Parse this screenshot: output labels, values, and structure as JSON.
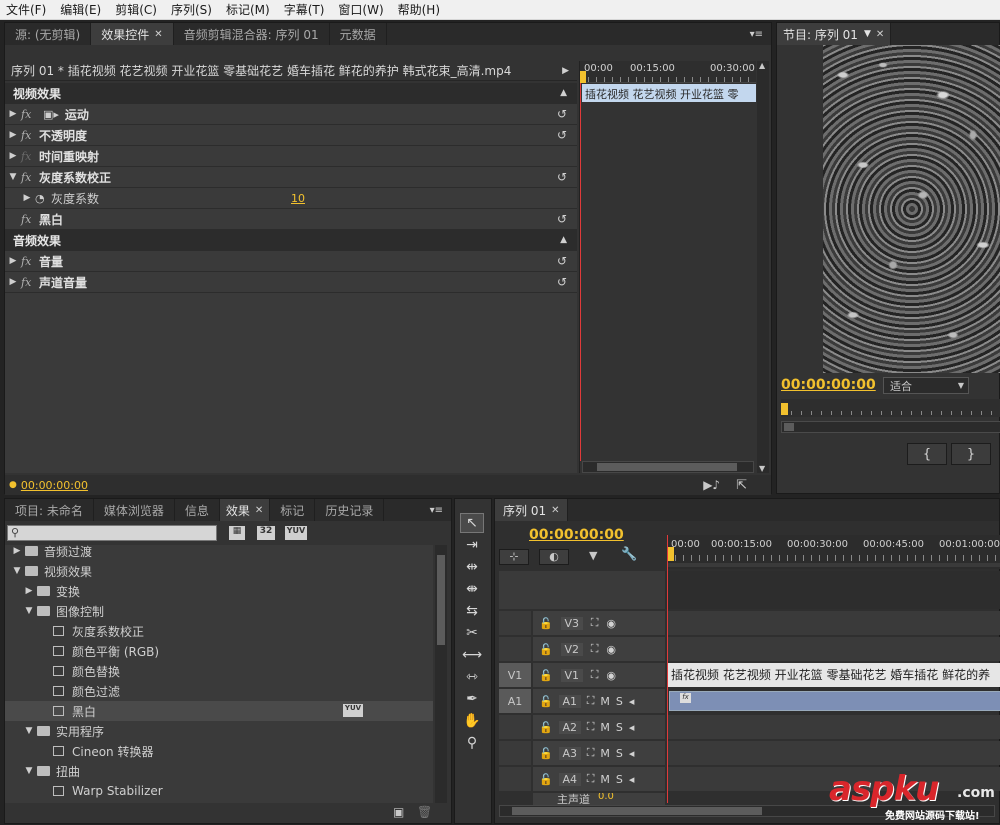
{
  "menubar": [
    "文件(F)",
    "编辑(E)",
    "剪辑(C)",
    "序列(S)",
    "标记(M)",
    "字幕(T)",
    "窗口(W)",
    "帮助(H)"
  ],
  "top_tabs": {
    "source": "源: (无剪辑)",
    "effect_controls": "效果控件",
    "audio_mixer": "音频剪辑混合器: 序列 01",
    "metadata": "元数据"
  },
  "effect_controls": {
    "clip_header": "序列 01 * 插花视频 花艺视频 开业花篮 零基础花艺 婚车插花 鲜花的养护 韩式花束_高清.mp4",
    "timecodes": [
      "00:00",
      "00:15:00",
      "00:30:00"
    ],
    "clip_bar": "插花视频 花艺视频 开业花篮 零",
    "video_section": "视频效果",
    "audio_section": "音频效果",
    "rows": [
      {
        "name": "运动",
        "fx": "fx",
        "expand": "▶"
      },
      {
        "name": "不透明度",
        "fx": "fx",
        "expand": "▶"
      },
      {
        "name": "时间重映射",
        "fx": "fx",
        "expand": "▶"
      },
      {
        "name": "灰度系数校正",
        "fx": "fx",
        "expand": "▼"
      },
      {
        "name": "灰度系数",
        "value": "10"
      },
      {
        "name": "黑白",
        "fx": "fx"
      }
    ],
    "audio_rows": [
      {
        "name": "音量",
        "fx": "fx"
      },
      {
        "name": "声道音量",
        "fx": "fx"
      }
    ],
    "footer_time": "00:00:00:00"
  },
  "program": {
    "tab": "节目: 序列 01",
    "timecode": "00:00:00:00",
    "fit": "适合"
  },
  "bottom_tabs": [
    "项目: 未命名",
    "媒体浏览器",
    "信息",
    "效果",
    "标记",
    "历史记录"
  ],
  "effects_tree": {
    "search_placeholder": "",
    "badges": [
      "32",
      "YUV"
    ],
    "items": [
      {
        "label": "音频过渡",
        "level": 0,
        "type": "folder",
        "expand": "▶"
      },
      {
        "label": "视频效果",
        "level": 0,
        "type": "folder",
        "expand": "▼"
      },
      {
        "label": "变换",
        "level": 1,
        "type": "folder",
        "expand": "▶"
      },
      {
        "label": "图像控制",
        "level": 1,
        "type": "folder",
        "expand": "▼"
      },
      {
        "label": "灰度系数校正",
        "level": 2,
        "type": "file"
      },
      {
        "label": "颜色平衡 (RGB)",
        "level": 2,
        "type": "file"
      },
      {
        "label": "颜色替换",
        "level": 2,
        "type": "file"
      },
      {
        "label": "颜色过滤",
        "level": 2,
        "type": "file"
      },
      {
        "label": "黑白",
        "level": 2,
        "type": "file",
        "selected": true,
        "badge": "YUV"
      },
      {
        "label": "实用程序",
        "level": 1,
        "type": "folder",
        "expand": "▼"
      },
      {
        "label": "Cineon 转换器",
        "level": 2,
        "type": "file"
      },
      {
        "label": "扭曲",
        "level": 1,
        "type": "folder",
        "expand": "▼"
      },
      {
        "label": "Warp Stabilizer",
        "level": 2,
        "type": "file"
      }
    ]
  },
  "timeline": {
    "tab": "序列 01",
    "timecode": "00:00:00:00",
    "ruler": [
      "00:00",
      "00:00:15:00",
      "00:00:30:00",
      "00:00:45:00",
      "00:01:00:00"
    ],
    "tracks": [
      {
        "name": "V3",
        "kind": "video"
      },
      {
        "name": "V2",
        "kind": "video"
      },
      {
        "name": "V1",
        "kind": "video",
        "source": "V1",
        "clip": "插花视频 花艺视频 开业花篮 零基础花艺 婚车插花 鲜花的养"
      },
      {
        "name": "A1",
        "kind": "audio",
        "source": "A1"
      },
      {
        "name": "A2",
        "kind": "audio"
      },
      {
        "name": "A3",
        "kind": "audio"
      },
      {
        "name": "A4",
        "kind": "audio"
      },
      {
        "name": "主声道",
        "kind": "master",
        "value": "0.0"
      }
    ],
    "m_label": "M",
    "s_label": "S"
  },
  "watermark": {
    "brand": "aspku",
    "tld": ".com",
    "tagline": "免费网站源码下载站!"
  },
  "colors": {
    "accent_yellow": "#f2c12e",
    "playhead_red": "#e03a3a",
    "clip_blue": "#7d8fb5",
    "watermark_red": "#d9262b"
  }
}
